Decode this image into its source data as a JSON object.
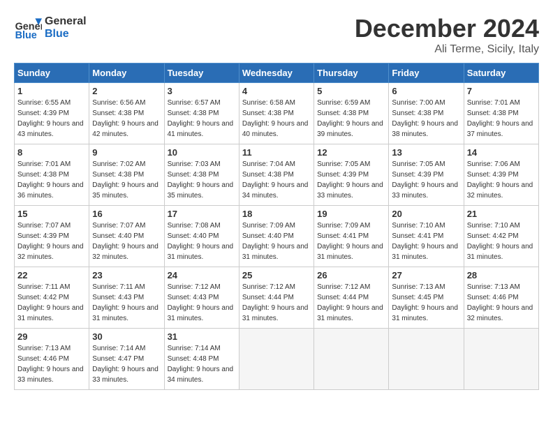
{
  "header": {
    "logo_line1": "General",
    "logo_line2": "Blue",
    "title": "December 2024",
    "location": "Ali Terme, Sicily, Italy"
  },
  "days_of_week": [
    "Sunday",
    "Monday",
    "Tuesday",
    "Wednesday",
    "Thursday",
    "Friday",
    "Saturday"
  ],
  "weeks": [
    [
      {
        "day": 1,
        "sunrise": "6:55 AM",
        "sunset": "4:39 PM",
        "daylight": "9 hours and 43 minutes."
      },
      {
        "day": 2,
        "sunrise": "6:56 AM",
        "sunset": "4:38 PM",
        "daylight": "9 hours and 42 minutes."
      },
      {
        "day": 3,
        "sunrise": "6:57 AM",
        "sunset": "4:38 PM",
        "daylight": "9 hours and 41 minutes."
      },
      {
        "day": 4,
        "sunrise": "6:58 AM",
        "sunset": "4:38 PM",
        "daylight": "9 hours and 40 minutes."
      },
      {
        "day": 5,
        "sunrise": "6:59 AM",
        "sunset": "4:38 PM",
        "daylight": "9 hours and 39 minutes."
      },
      {
        "day": 6,
        "sunrise": "7:00 AM",
        "sunset": "4:38 PM",
        "daylight": "9 hours and 38 minutes."
      },
      {
        "day": 7,
        "sunrise": "7:01 AM",
        "sunset": "4:38 PM",
        "daylight": "9 hours and 37 minutes."
      }
    ],
    [
      {
        "day": 8,
        "sunrise": "7:01 AM",
        "sunset": "4:38 PM",
        "daylight": "9 hours and 36 minutes."
      },
      {
        "day": 9,
        "sunrise": "7:02 AM",
        "sunset": "4:38 PM",
        "daylight": "9 hours and 35 minutes."
      },
      {
        "day": 10,
        "sunrise": "7:03 AM",
        "sunset": "4:38 PM",
        "daylight": "9 hours and 35 minutes."
      },
      {
        "day": 11,
        "sunrise": "7:04 AM",
        "sunset": "4:38 PM",
        "daylight": "9 hours and 34 minutes."
      },
      {
        "day": 12,
        "sunrise": "7:05 AM",
        "sunset": "4:39 PM",
        "daylight": "9 hours and 33 minutes."
      },
      {
        "day": 13,
        "sunrise": "7:05 AM",
        "sunset": "4:39 PM",
        "daylight": "9 hours and 33 minutes."
      },
      {
        "day": 14,
        "sunrise": "7:06 AM",
        "sunset": "4:39 PM",
        "daylight": "9 hours and 32 minutes."
      }
    ],
    [
      {
        "day": 15,
        "sunrise": "7:07 AM",
        "sunset": "4:39 PM",
        "daylight": "9 hours and 32 minutes."
      },
      {
        "day": 16,
        "sunrise": "7:07 AM",
        "sunset": "4:40 PM",
        "daylight": "9 hours and 32 minutes."
      },
      {
        "day": 17,
        "sunrise": "7:08 AM",
        "sunset": "4:40 PM",
        "daylight": "9 hours and 31 minutes."
      },
      {
        "day": 18,
        "sunrise": "7:09 AM",
        "sunset": "4:40 PM",
        "daylight": "9 hours and 31 minutes."
      },
      {
        "day": 19,
        "sunrise": "7:09 AM",
        "sunset": "4:41 PM",
        "daylight": "9 hours and 31 minutes."
      },
      {
        "day": 20,
        "sunrise": "7:10 AM",
        "sunset": "4:41 PM",
        "daylight": "9 hours and 31 minutes."
      },
      {
        "day": 21,
        "sunrise": "7:10 AM",
        "sunset": "4:42 PM",
        "daylight": "9 hours and 31 minutes."
      }
    ],
    [
      {
        "day": 22,
        "sunrise": "7:11 AM",
        "sunset": "4:42 PM",
        "daylight": "9 hours and 31 minutes."
      },
      {
        "day": 23,
        "sunrise": "7:11 AM",
        "sunset": "4:43 PM",
        "daylight": "9 hours and 31 minutes."
      },
      {
        "day": 24,
        "sunrise": "7:12 AM",
        "sunset": "4:43 PM",
        "daylight": "9 hours and 31 minutes."
      },
      {
        "day": 25,
        "sunrise": "7:12 AM",
        "sunset": "4:44 PM",
        "daylight": "9 hours and 31 minutes."
      },
      {
        "day": 26,
        "sunrise": "7:12 AM",
        "sunset": "4:44 PM",
        "daylight": "9 hours and 31 minutes."
      },
      {
        "day": 27,
        "sunrise": "7:13 AM",
        "sunset": "4:45 PM",
        "daylight": "9 hours and 31 minutes."
      },
      {
        "day": 28,
        "sunrise": "7:13 AM",
        "sunset": "4:46 PM",
        "daylight": "9 hours and 32 minutes."
      }
    ],
    [
      {
        "day": 29,
        "sunrise": "7:13 AM",
        "sunset": "4:46 PM",
        "daylight": "9 hours and 33 minutes."
      },
      {
        "day": 30,
        "sunrise": "7:14 AM",
        "sunset": "4:47 PM",
        "daylight": "9 hours and 33 minutes."
      },
      {
        "day": 31,
        "sunrise": "7:14 AM",
        "sunset": "4:48 PM",
        "daylight": "9 hours and 34 minutes."
      },
      null,
      null,
      null,
      null
    ]
  ]
}
